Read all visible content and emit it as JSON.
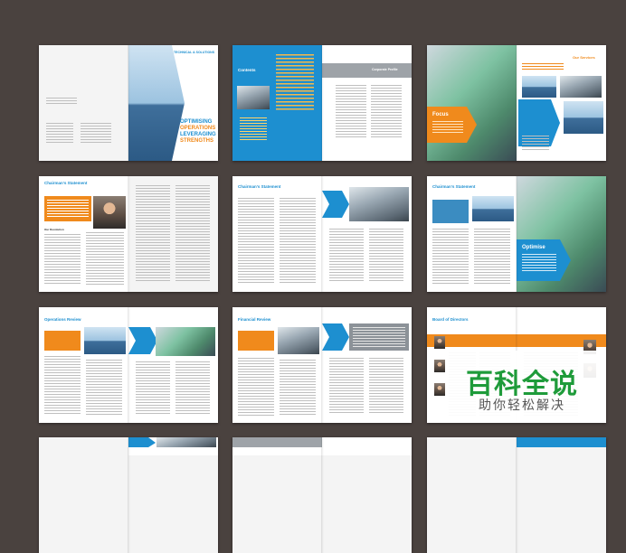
{
  "cover": {
    "brand_line": "TECHNICAL & SOLUTIONS",
    "headline": [
      "OPTIMISING",
      "OPERATIONS",
      "LEVERAGING",
      "STRENGTHS"
    ]
  },
  "contents": {
    "title": "Contents",
    "right_title": "Corporate Profile"
  },
  "focus": {
    "word": "Focus",
    "right_title": "Our Services"
  },
  "chairman1": {
    "title": "Chairman's Statement",
    "left_title": "Our Revolution"
  },
  "chairman2": {
    "title": "Chairman's Statement"
  },
  "chairman3": {
    "title": "Chairman's Statement",
    "word": "Optimise"
  },
  "operations": {
    "title": "Operations Review"
  },
  "financial": {
    "title": "Financial Review"
  },
  "board": {
    "title": "Board of Directors"
  },
  "watermark": {
    "main": "百科全说",
    "sub": "助你轻松解决"
  },
  "colors": {
    "blue": "#1d8fd0",
    "orange": "#f08a1c",
    "background": "#4a423f"
  }
}
